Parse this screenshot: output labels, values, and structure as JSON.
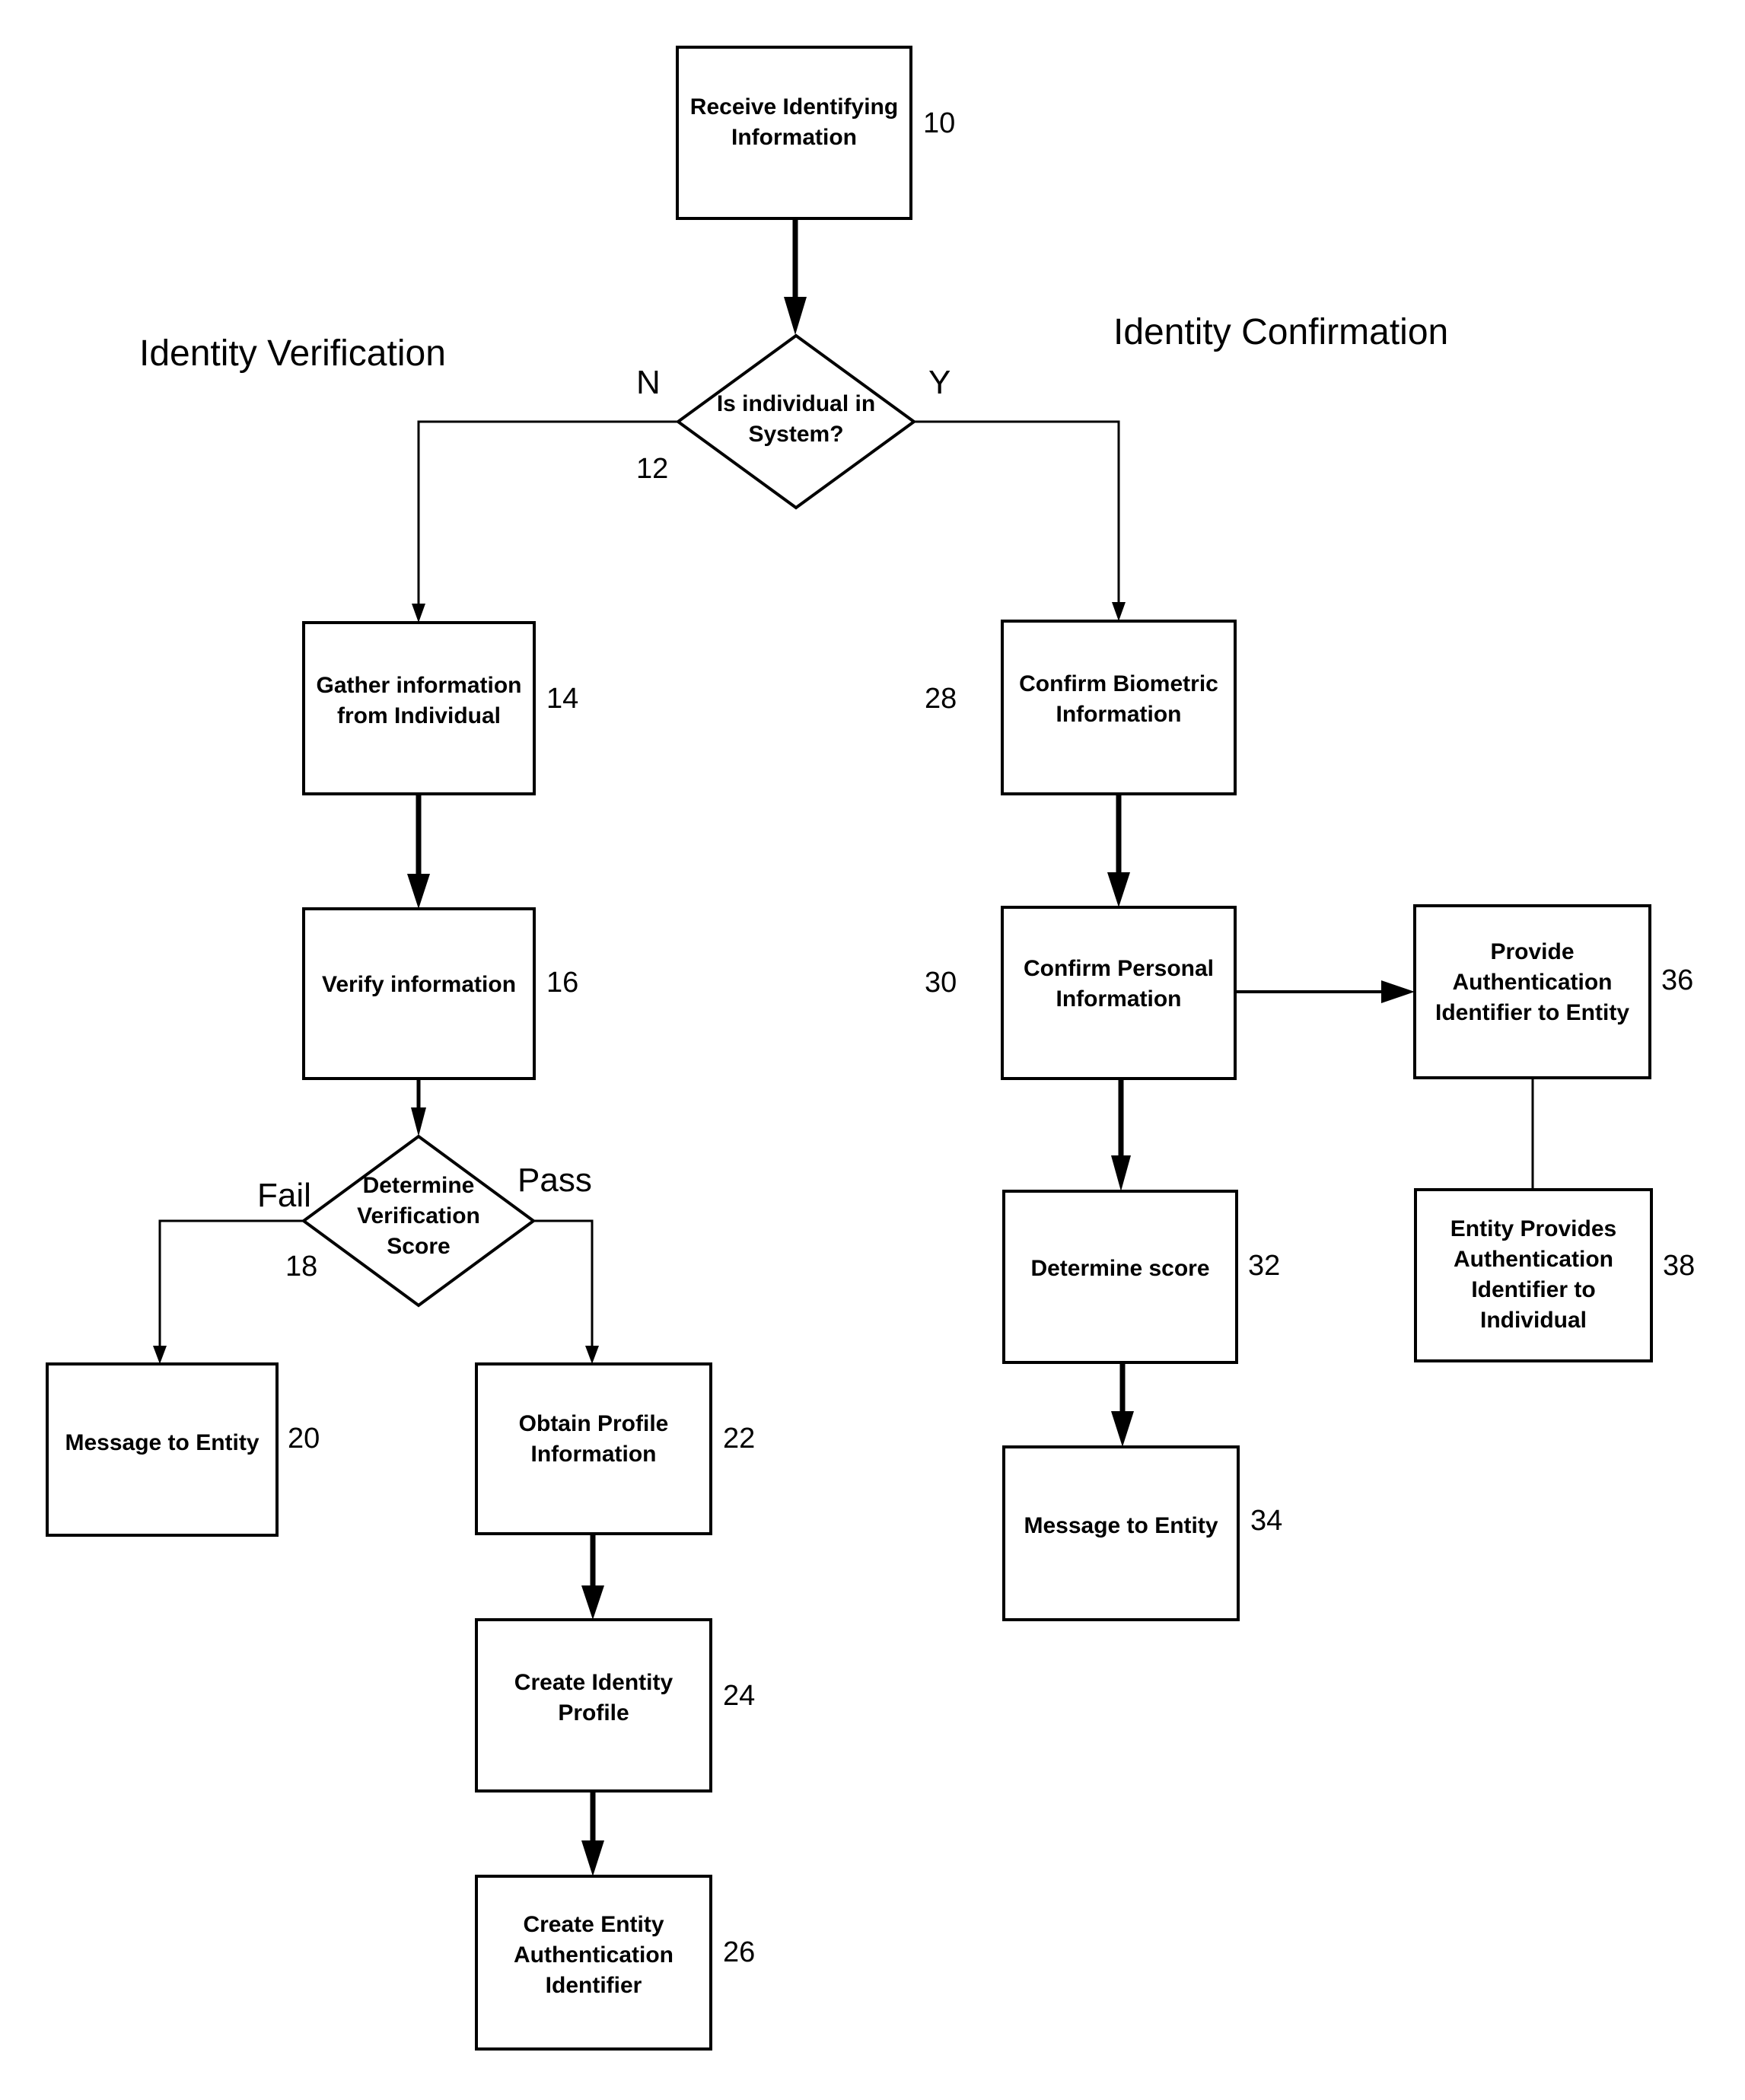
{
  "sections": {
    "verification": "Identity Verification",
    "confirmation": "Identity Confirmation"
  },
  "nodes": {
    "n10": {
      "ref": "10",
      "lines": [
        "Receive Identifying",
        "Information"
      ]
    },
    "n12": {
      "ref": "12",
      "lines": [
        "Is individual in",
        "System?"
      ]
    },
    "n14": {
      "ref": "14",
      "lines": [
        "Gather information",
        "from Individual"
      ]
    },
    "n16": {
      "ref": "16",
      "lines": [
        "Verify information"
      ]
    },
    "n18": {
      "ref": "18",
      "lines": [
        "Determine",
        "Verification",
        "Score"
      ]
    },
    "n20": {
      "ref": "20",
      "lines": [
        "Message to Entity"
      ]
    },
    "n22": {
      "ref": "22",
      "lines": [
        "Obtain Profile",
        "Information"
      ]
    },
    "n24": {
      "ref": "24",
      "lines": [
        "Create Identity",
        "Profile"
      ]
    },
    "n26": {
      "ref": "26",
      "lines": [
        "Create Entity",
        "Authentication",
        "Identifier"
      ]
    },
    "n28": {
      "ref": "28",
      "lines": [
        "Confirm Biometric",
        "Information"
      ]
    },
    "n30": {
      "ref": "30",
      "lines": [
        "Confirm Personal",
        "Information"
      ]
    },
    "n32": {
      "ref": "32",
      "lines": [
        "Determine score"
      ]
    },
    "n34": {
      "ref": "34",
      "lines": [
        "Message to Entity"
      ]
    },
    "n36": {
      "ref": "36",
      "lines": [
        "Provide",
        "Authentication",
        "Identifier to Entity"
      ]
    },
    "n38": {
      "ref": "38",
      "lines": [
        "Entity Provides",
        "Authentication",
        "Identifier to",
        "Individual"
      ]
    }
  },
  "branches": {
    "no": "N",
    "yes": "Y",
    "fail": "Fail",
    "pass": "Pass"
  },
  "edges": [
    {
      "from": "n10",
      "to": "n12"
    },
    {
      "from": "n12",
      "to": "n14",
      "label": "N"
    },
    {
      "from": "n12",
      "to": "n28",
      "label": "Y"
    },
    {
      "from": "n14",
      "to": "n16"
    },
    {
      "from": "n16",
      "to": "n18"
    },
    {
      "from": "n18",
      "to": "n20",
      "label": "Fail"
    },
    {
      "from": "n18",
      "to": "n22",
      "label": "Pass"
    },
    {
      "from": "n22",
      "to": "n24"
    },
    {
      "from": "n24",
      "to": "n26"
    },
    {
      "from": "n28",
      "to": "n30"
    },
    {
      "from": "n30",
      "to": "n32"
    },
    {
      "from": "n32",
      "to": "n34"
    },
    {
      "from": "n30",
      "to": "n36"
    },
    {
      "from": "n36",
      "to": "n38"
    }
  ]
}
